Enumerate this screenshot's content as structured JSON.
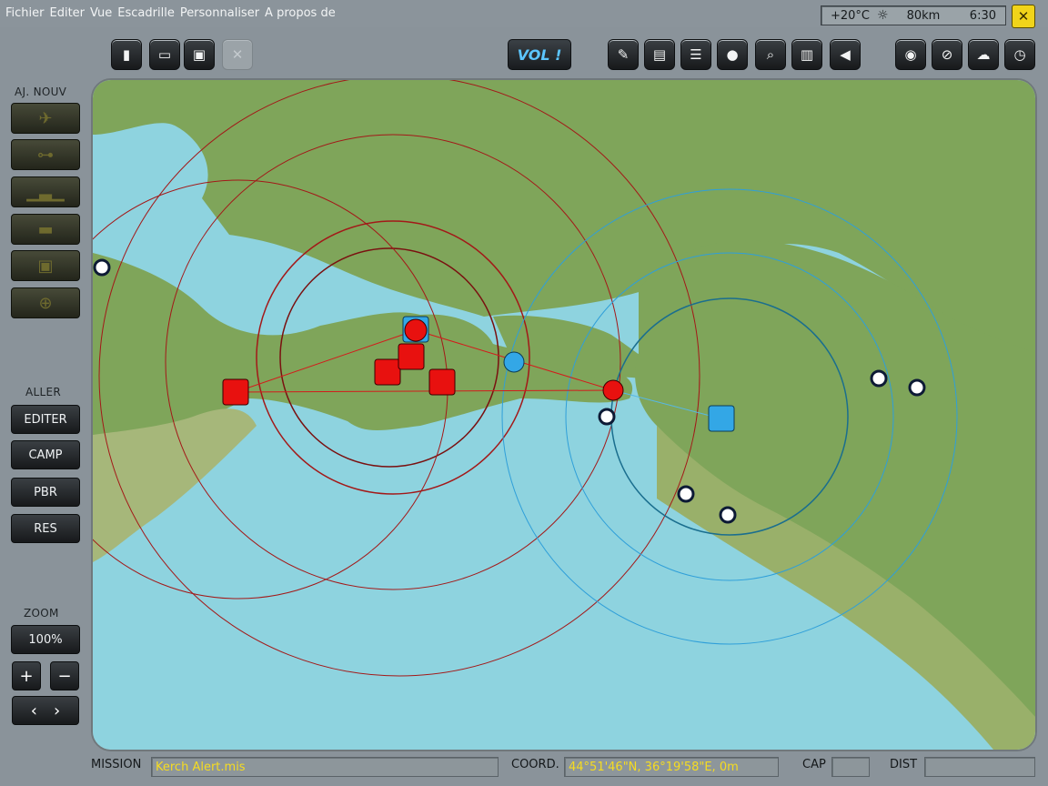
{
  "menu": [
    "Fichier",
    "Editer",
    "Vue",
    "Escadrille",
    "Personnaliser",
    "A propos de"
  ],
  "weather": {
    "temperature": "+20°C",
    "visibility": "80km",
    "time": "6:30"
  },
  "toolbar": {
    "fly_label": "VOL !"
  },
  "sidebar": {
    "add_new_label": "AJ. NOUV",
    "goto_label": "ALLER",
    "goto_buttons": [
      "EDITER",
      "CAMP",
      "PBR",
      "RES"
    ],
    "zoom_label": "ZOOM",
    "zoom_value": "100%",
    "zoom_in": "+",
    "zoom_out": "−",
    "prev": "‹",
    "next": "›"
  },
  "status": {
    "mission_label": "MISSION",
    "mission_value": "Kerch Alert.mis",
    "coord_label": "COORD.",
    "coord_value": "44°51'46\"N, 36°19'58\"E, 0m",
    "cap_label": "CAP",
    "cap_value": "",
    "dist_label": "DIST",
    "dist_value": ""
  },
  "colors": {
    "sea": "#8ed3df",
    "land": "#7fa55a",
    "red": "#e8110f",
    "blue": "#33a7e6",
    "accent_yellow": "#f6dc20"
  }
}
